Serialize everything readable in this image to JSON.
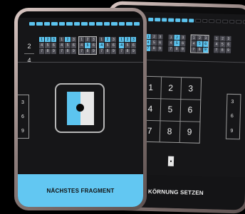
{
  "front": {
    "progress": {
      "total": 15,
      "filled": 15
    },
    "counter": {
      "current": "2",
      "total": "4"
    },
    "mini_grids": [
      {
        "highlight": [
          0,
          1,
          2
        ],
        "outlined": false
      },
      {
        "highlight": [
          1
        ],
        "outlined": false
      },
      {
        "highlight": [
          4
        ],
        "outlined": true
      },
      {
        "highlight": [
          1,
          3
        ],
        "outlined": false
      },
      {
        "highlight": [
          0,
          1,
          2,
          3
        ],
        "outlined": false
      }
    ],
    "mini_numbers": [
      "1",
      "2",
      "3",
      "4",
      "5",
      "6",
      "7",
      "8",
      "9"
    ],
    "side_numbers": [
      "3",
      "6",
      "9"
    ],
    "action_label": "NÄCHSTES FRAGMENT"
  },
  "back": {
    "progress": {
      "total": 15,
      "filled": 7
    },
    "mini_grids": [
      {
        "highlight": [
          0,
          3,
          6
        ],
        "outlined": false
      },
      {
        "highlight": [
          1,
          4
        ],
        "outlined": false
      },
      {
        "highlight": [
          4,
          5,
          8
        ],
        "outlined": true
      },
      {
        "highlight": [],
        "outlined": false
      }
    ],
    "mini_numbers": [
      "1",
      "2",
      "3",
      "4",
      "5",
      "6",
      "7",
      "8",
      "9"
    ],
    "grid_numbers": [
      "1",
      "2",
      "3",
      "4",
      "5",
      "6",
      "7",
      "8",
      "9"
    ],
    "side_numbers": [
      "3",
      "6",
      "9"
    ],
    "action_label": "KÖRNUNG SETZEN"
  },
  "colors": {
    "accent": "#5cc4ef",
    "panel": "#161618"
  }
}
